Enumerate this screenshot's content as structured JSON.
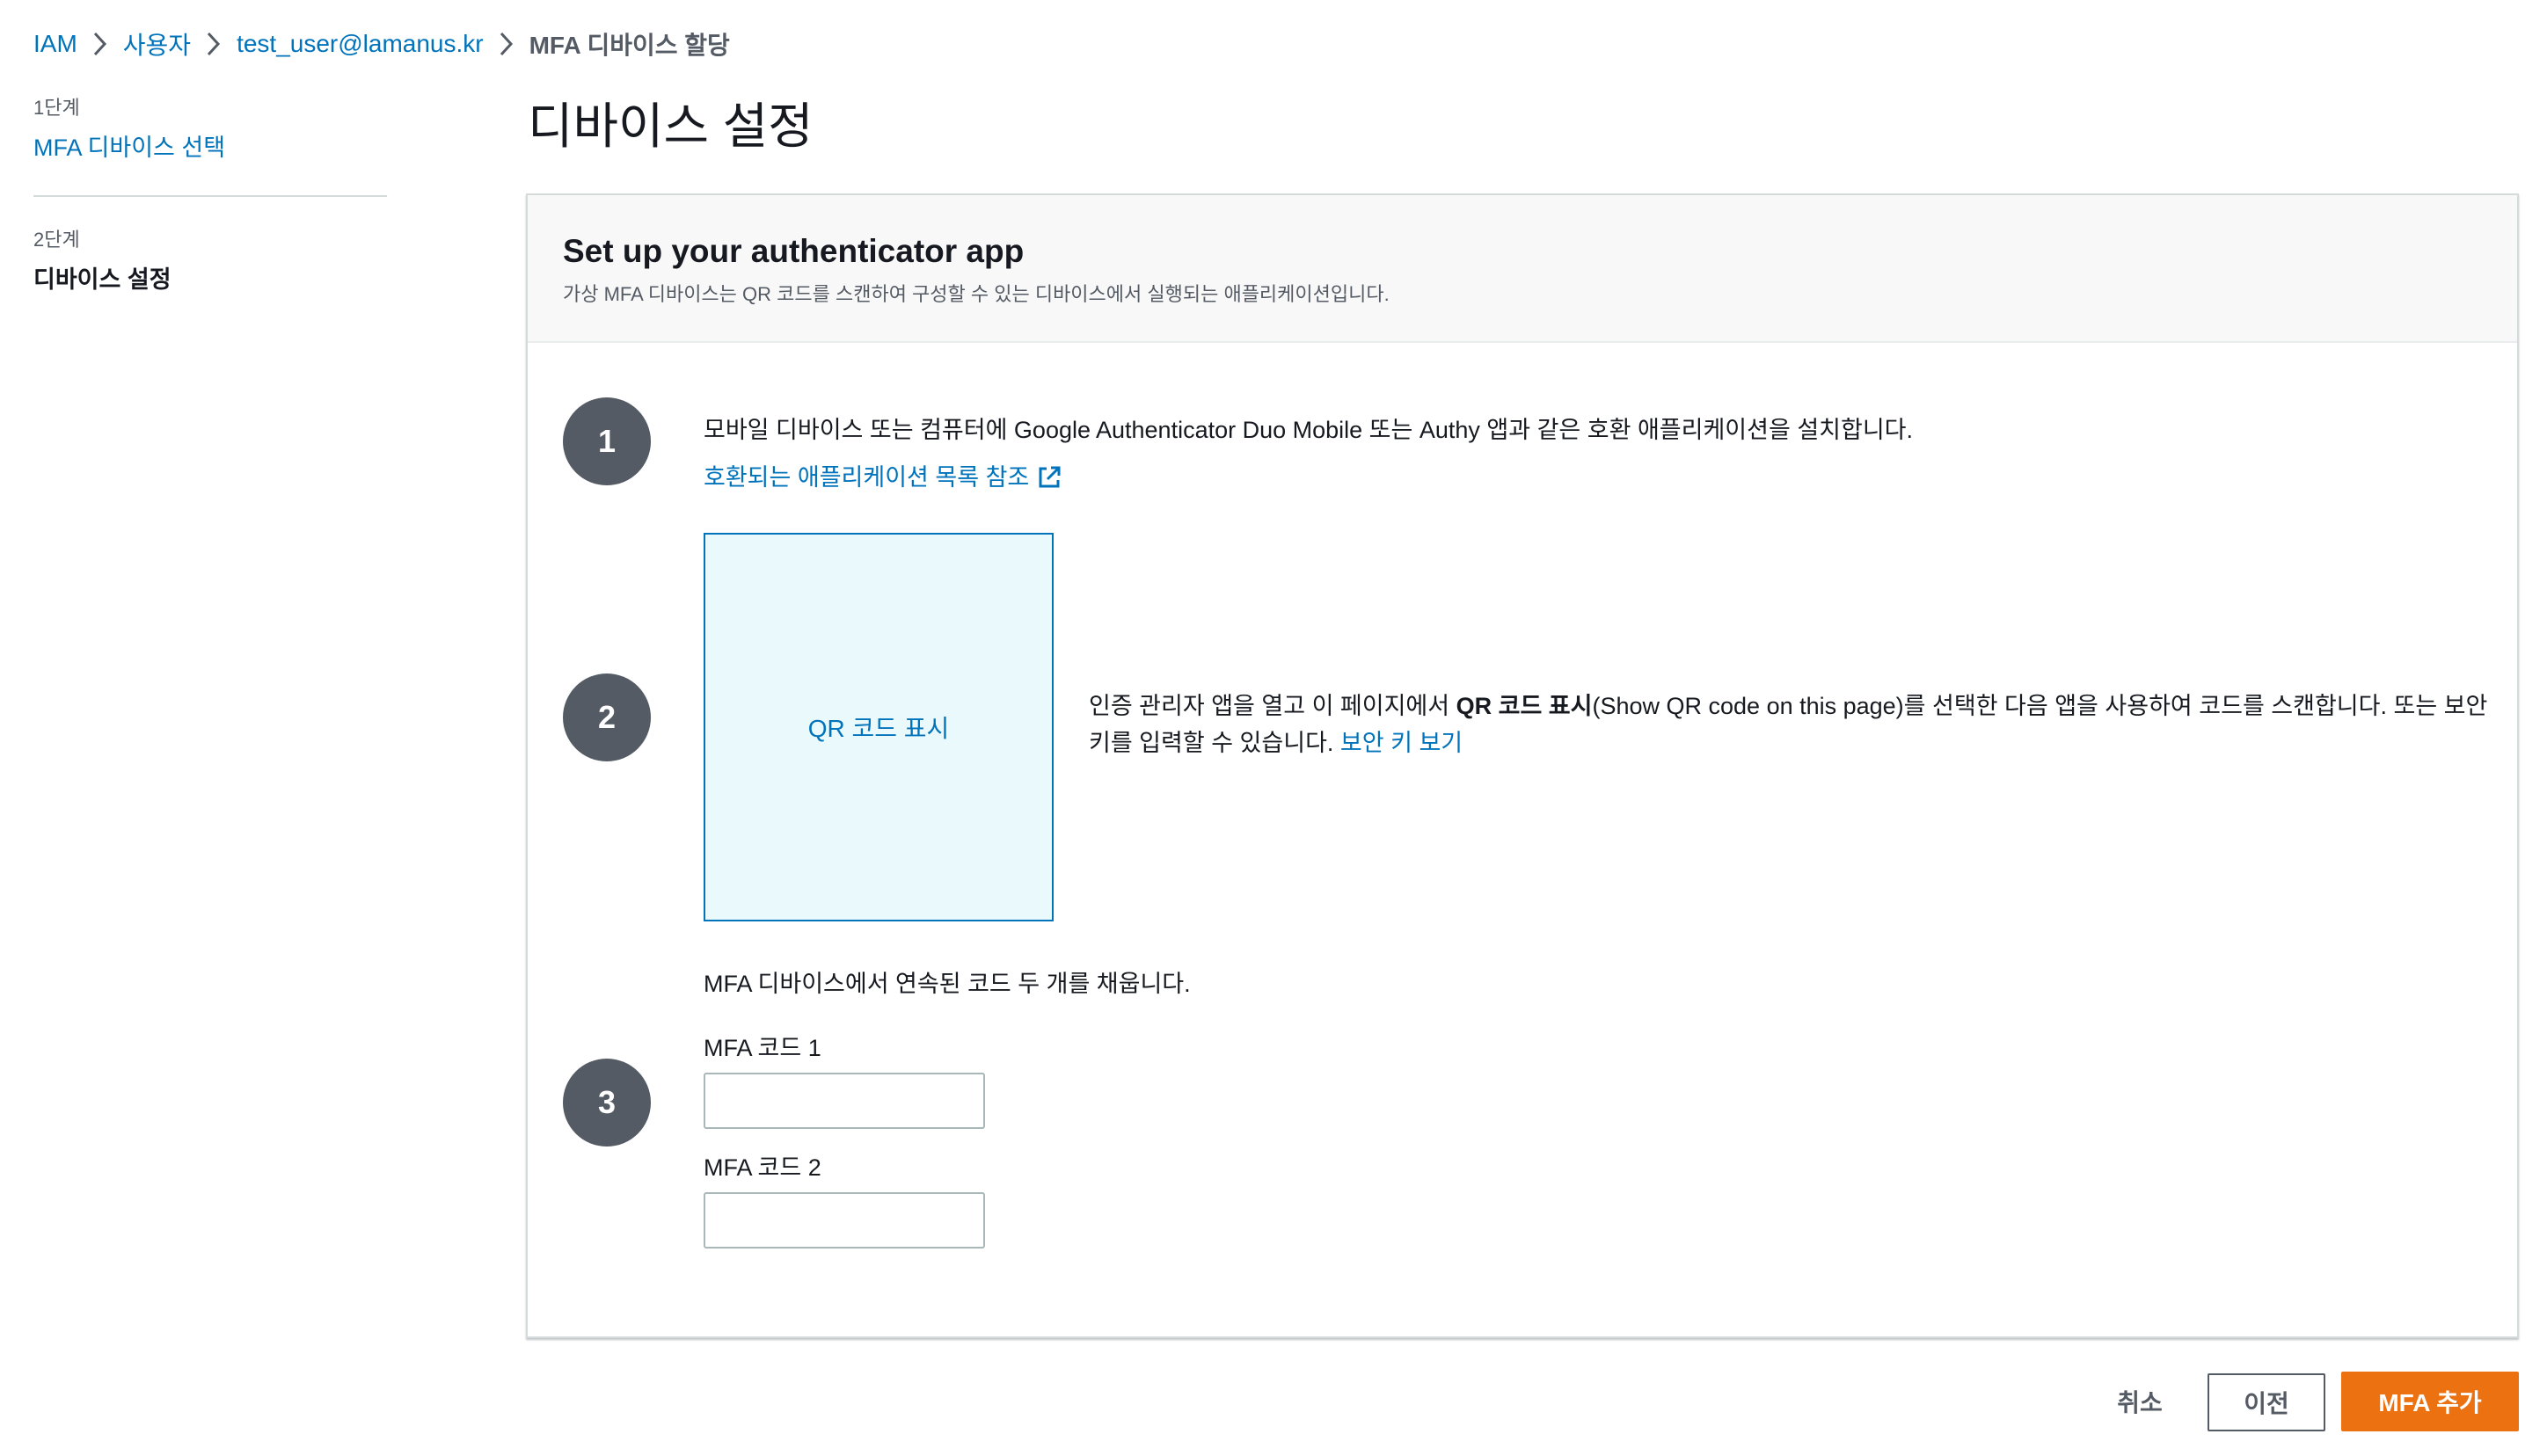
{
  "breadcrumb": {
    "items": [
      "IAM",
      "사용자",
      "test_user@lamanus.kr"
    ],
    "current": "MFA 디바이스 할당"
  },
  "wizard": {
    "steps": [
      {
        "number": "1단계",
        "label": "MFA 디바이스 선택"
      },
      {
        "number": "2단계",
        "label": "디바이스 설정"
      }
    ]
  },
  "page": {
    "title": "디바이스 설정"
  },
  "card": {
    "title": "Set up your authenticator app",
    "description": "가상 MFA 디바이스는 QR 코드를 스캔하여 구성할 수 있는 디바이스에서 실행되는 애플리케이션입니다."
  },
  "step1": {
    "number": "1",
    "text": "모바일 디바이스 또는 컴퓨터에 Google Authenticator Duo Mobile 또는 Authy 앱과 같은 호환 애플리케이션을 설치합니다.",
    "link": "호환되는 애플리케이션 목록 참조"
  },
  "step2": {
    "number": "2",
    "qr_label": "QR 코드 표시",
    "text_before": "인증 관리자 앱을 열고 이 페이지에서 ",
    "text_bold": "QR 코드 표시",
    "text_after": "(Show QR code on this page)를 선택한 다음 앱을 사용하여 코드를 스캔합니다. 또는 보안 키를 입력할 수 있습니다. ",
    "link": "보안 키 보기"
  },
  "step3": {
    "number": "3",
    "text": "MFA 디바이스에서 연속된 코드 두 개를 채웁니다.",
    "code1_label": "MFA 코드 1",
    "code1_value": "",
    "code2_label": "MFA 코드 2",
    "code2_value": ""
  },
  "footer": {
    "cancel": "취소",
    "previous": "이전",
    "submit": "MFA 추가"
  },
  "colors": {
    "link": "#0073bb",
    "primary": "#ec7211",
    "step_circle": "#545b64",
    "qr_background": "#e9f9fc"
  },
  "icons": {
    "breadcrumb_separator": "chevron-right-icon",
    "external_link": "external-link-icon"
  }
}
